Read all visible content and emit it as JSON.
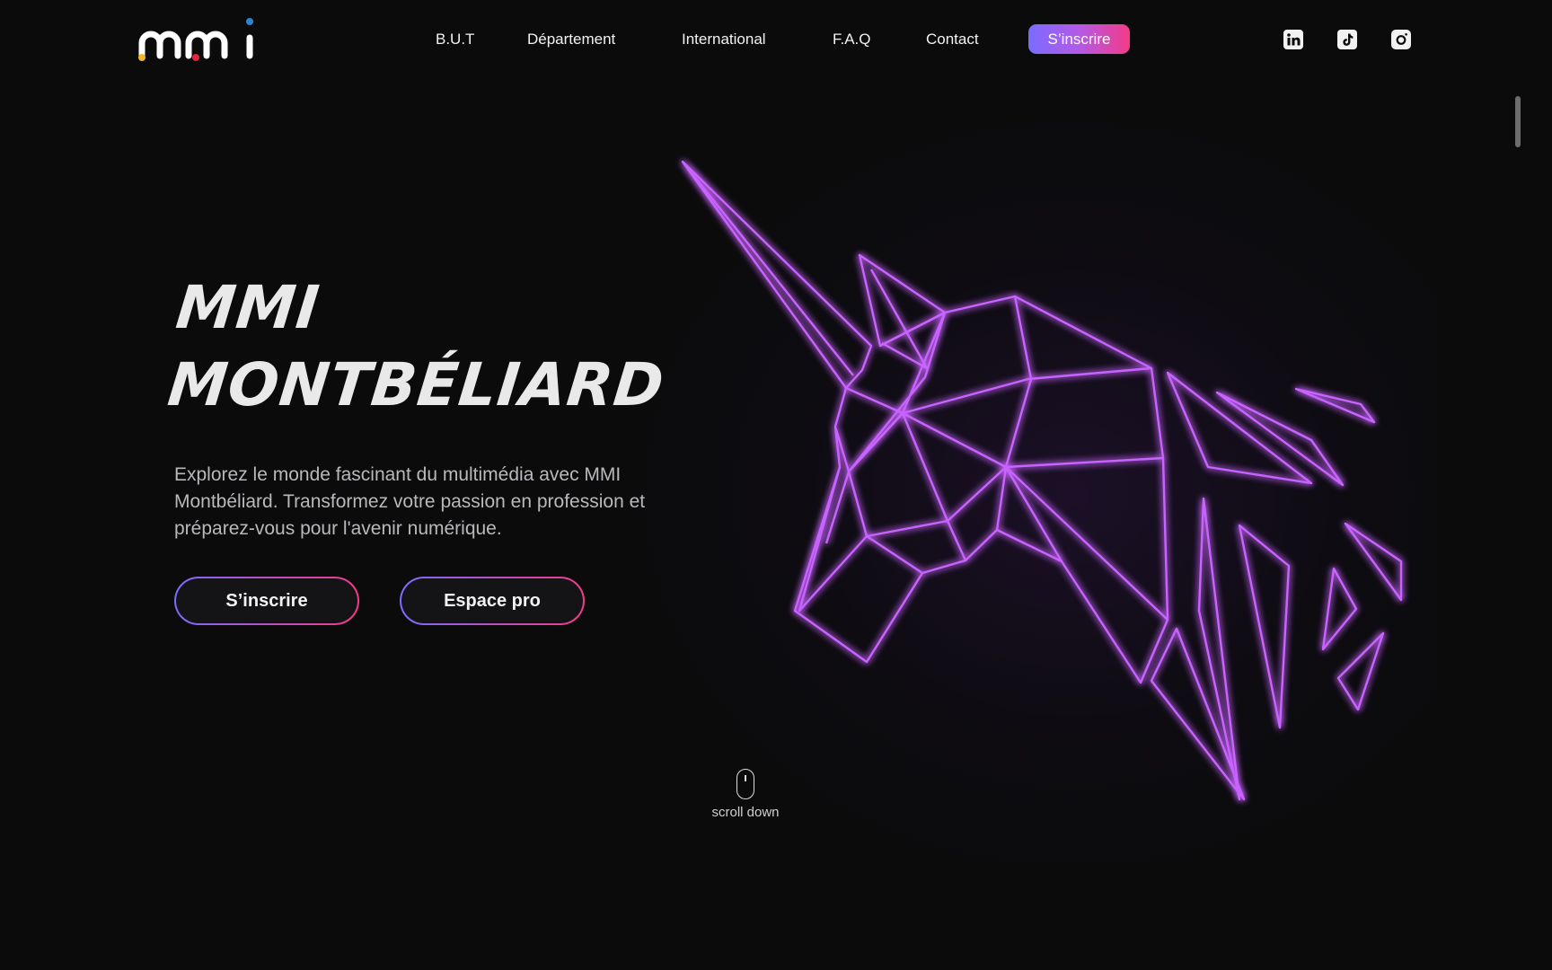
{
  "header": {
    "logo_text": "mmi",
    "nav": [
      {
        "label": "B.U.T"
      },
      {
        "label": "Département"
      },
      {
        "label": "International"
      },
      {
        "label": "F.A.Q"
      },
      {
        "label": "Contact"
      }
    ],
    "cta_label": "S’inscrire",
    "social": [
      {
        "icon": "linkedin-icon"
      },
      {
        "icon": "tiktok-icon"
      },
      {
        "icon": "instagram-icon"
      }
    ]
  },
  "hero": {
    "title_line1": "MMI",
    "title_line2": "MONTBÉLIARD",
    "description": "Explorez le monde fascinant du multimédia avec MMI Montbéliard. Transformez votre passion en profession et préparez-vous pour l'avenir numérique.",
    "primary_button": "S’inscrire",
    "secondary_button": "Espace pro",
    "illustration_icon": "unicorn-head-icon"
  },
  "scroll_hint": {
    "label": "scroll down",
    "icon": "mouse-icon"
  },
  "colors": {
    "background": "#0b0b0c",
    "gradient_start": "#7a6cff",
    "gradient_end": "#f43b86",
    "neon": "#c964ff",
    "text": "#f2f2f2",
    "muted_text": "#b9b9bd"
  }
}
